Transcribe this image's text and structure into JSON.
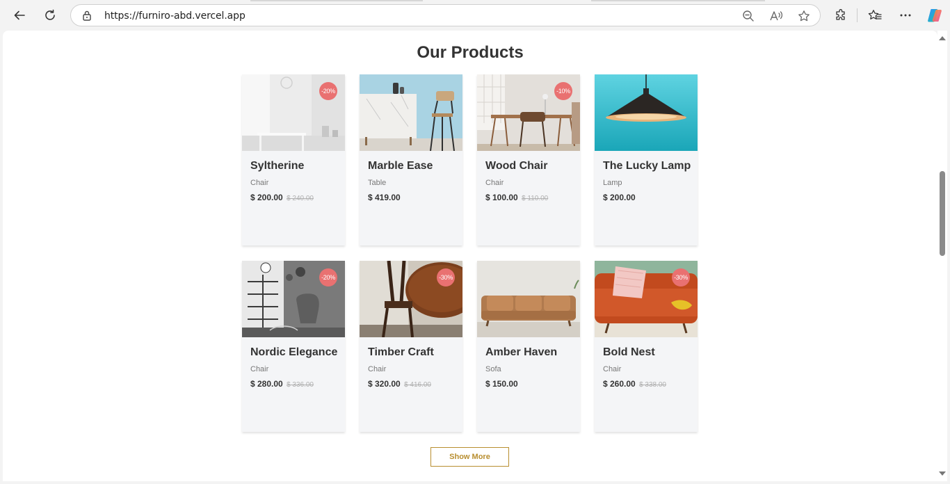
{
  "browser": {
    "url": "https://furniro-abd.vercel.app"
  },
  "page": {
    "section_title": "Our Products",
    "show_more_label": "Show More"
  },
  "products": [
    {
      "name": "Syltherine",
      "category": "Chair",
      "price": "$ 200.00",
      "old_price": "$ 240.00",
      "badge": "-20%"
    },
    {
      "name": "Marble Ease",
      "category": "Table",
      "price": "$ 419.00",
      "old_price": "",
      "badge": ""
    },
    {
      "name": "Wood Chair",
      "category": "Chair",
      "price": "$ 100.00",
      "old_price": "$ 110.00",
      "badge": "-10%"
    },
    {
      "name": "The Lucky Lamp",
      "category": "Lamp",
      "price": "$ 200.00",
      "old_price": "",
      "badge": ""
    },
    {
      "name": "Nordic Elegance",
      "category": "Chair",
      "price": "$ 280.00",
      "old_price": "$ 336.00",
      "badge": "-20%"
    },
    {
      "name": "Timber Craft",
      "category": "Chair",
      "price": "$ 320.00",
      "old_price": "$ 416.00",
      "badge": "-30%"
    },
    {
      "name": "Amber Haven",
      "category": "Sofa",
      "price": "$ 150.00",
      "old_price": "",
      "badge": ""
    },
    {
      "name": "Bold Nest",
      "category": "Chair",
      "price": "$ 260.00",
      "old_price": "$ 338.00",
      "badge": "-30%"
    }
  ],
  "colors": {
    "badge": "#e97171",
    "accent": "#b88e2f"
  }
}
